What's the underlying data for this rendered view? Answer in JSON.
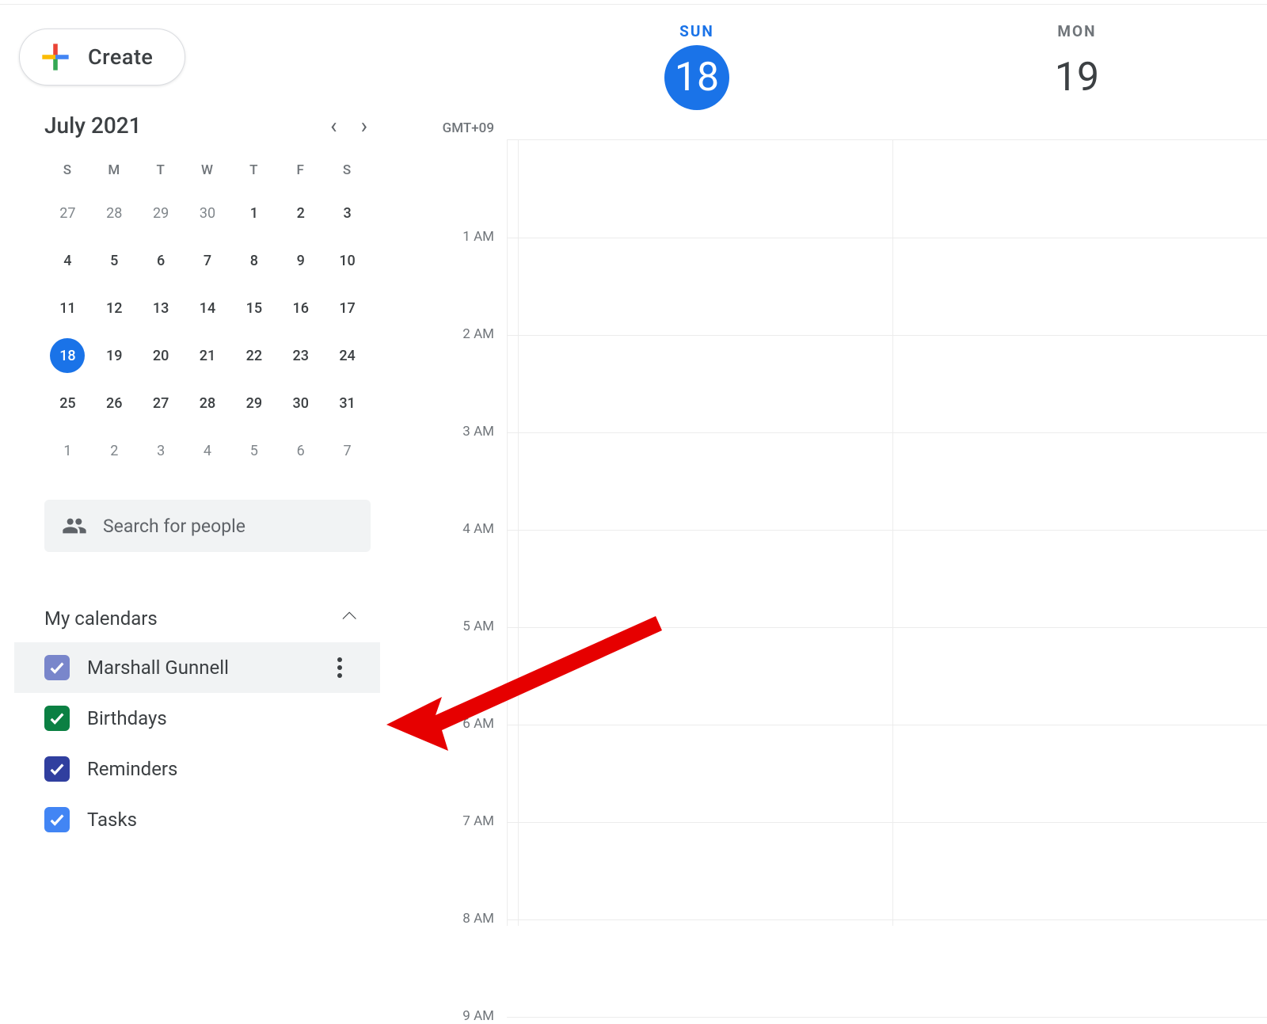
{
  "create_label": "Create",
  "timezone": "GMT+09",
  "mini_calendar": {
    "month_label": "July 2021",
    "dow": [
      "S",
      "M",
      "T",
      "W",
      "T",
      "F",
      "S"
    ],
    "cells": [
      {
        "d": "27",
        "muted": true
      },
      {
        "d": "28",
        "muted": true
      },
      {
        "d": "29",
        "muted": true
      },
      {
        "d": "30",
        "muted": true
      },
      {
        "d": "1"
      },
      {
        "d": "2"
      },
      {
        "d": "3"
      },
      {
        "d": "4"
      },
      {
        "d": "5"
      },
      {
        "d": "6"
      },
      {
        "d": "7"
      },
      {
        "d": "8"
      },
      {
        "d": "9"
      },
      {
        "d": "10"
      },
      {
        "d": "11"
      },
      {
        "d": "12"
      },
      {
        "d": "13"
      },
      {
        "d": "14"
      },
      {
        "d": "15"
      },
      {
        "d": "16"
      },
      {
        "d": "17"
      },
      {
        "d": "18",
        "today": true
      },
      {
        "d": "19"
      },
      {
        "d": "20"
      },
      {
        "d": "21"
      },
      {
        "d": "22"
      },
      {
        "d": "23"
      },
      {
        "d": "24"
      },
      {
        "d": "25"
      },
      {
        "d": "26"
      },
      {
        "d": "27"
      },
      {
        "d": "28"
      },
      {
        "d": "29"
      },
      {
        "d": "30"
      },
      {
        "d": "31"
      },
      {
        "d": "1",
        "muted": true
      },
      {
        "d": "2",
        "muted": true
      },
      {
        "d": "3",
        "muted": true
      },
      {
        "d": "4",
        "muted": true
      },
      {
        "d": "5",
        "muted": true
      },
      {
        "d": "6",
        "muted": true
      },
      {
        "d": "7",
        "muted": true
      }
    ]
  },
  "search": {
    "placeholder": "Search for people"
  },
  "sections": {
    "my_calendars": {
      "title": "My calendars",
      "items": [
        {
          "label": "Marshall Gunnell",
          "color": "#7986cb",
          "checked": true,
          "hover": true
        },
        {
          "label": "Birthdays",
          "color": "#0b8043",
          "checked": true
        },
        {
          "label": "Reminders",
          "color": "#303f9f",
          "checked": true
        },
        {
          "label": "Tasks",
          "color": "#4285f4",
          "checked": true
        }
      ]
    }
  },
  "day_columns": [
    {
      "dow": "SUN",
      "num": "18",
      "today": true
    },
    {
      "dow": "MON",
      "num": "19",
      "today": false
    }
  ],
  "time_labels": [
    "1 AM",
    "2 AM",
    "3 AM",
    "4 AM",
    "5 AM",
    "6 AM",
    "7 AM",
    "8 AM",
    "9 AM"
  ]
}
